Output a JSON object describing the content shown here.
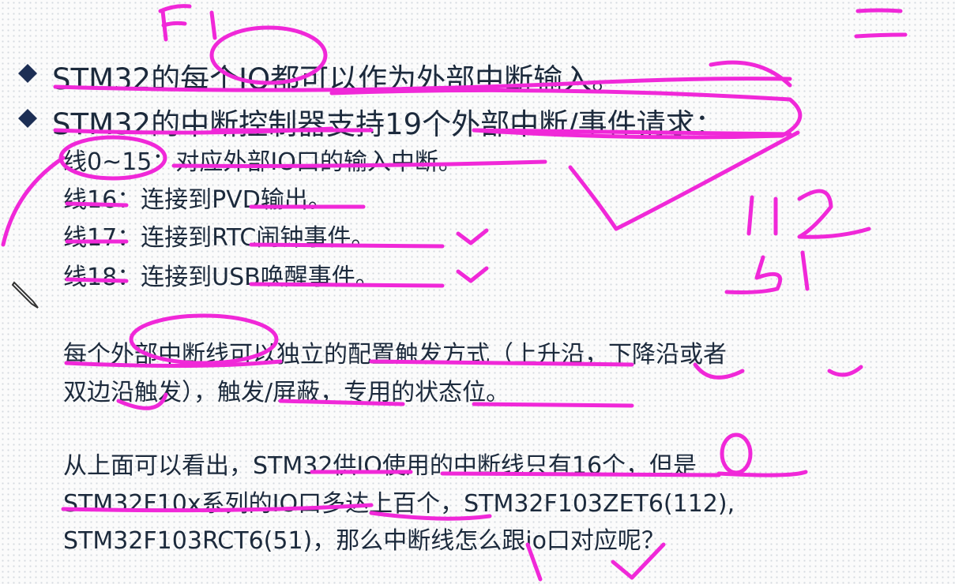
{
  "bullets": [
    "STM32的每个IO都可以作为外部中断输入。",
    "STM32的中断控制器支持19个外部中断/事件请求："
  ],
  "lines": [
    "线0~15：对应外部IO口的输入中断。",
    "线16：连接到PVD输出。",
    "线17：连接到RTC闹钟事件。",
    "线18：连接到USB唤醒事件。"
  ],
  "para1": [
    "每个外部中断线可以独立的配置触发方式（上升沿，下降沿或者",
    "双边沿触发），触发/屏蔽，专用的状态位。"
  ],
  "para2": [
    "从上面可以看出，STM32供IO使用的中断线只有16个，但是",
    "STM32F10x系列的IO口多达上百个，STM32F103ZET6(112),",
    "STM32F103RCT6(51)，那么中断线怎么跟io口对应呢？"
  ],
  "annotations": {
    "top_left": "F1",
    "top_right": "二",
    "mid_right_top": "112",
    "mid_right_bottom": "51"
  },
  "colors": {
    "text": "#1c2a3c",
    "ink": "#f028d8",
    "bullet": "#1d2f55"
  }
}
